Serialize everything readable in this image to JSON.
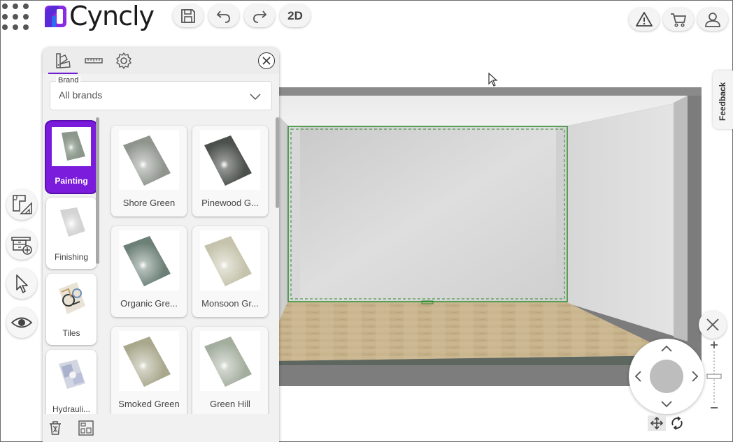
{
  "app": {
    "brand_name": "Cyncly",
    "toolbar": {
      "view_2d_label": "2D"
    }
  },
  "panel": {
    "brand_filter": {
      "legend": "Brand",
      "value": "All brands"
    },
    "categories": [
      {
        "label": "Painting",
        "active": true
      },
      {
        "label": "Finishing",
        "active": false
      },
      {
        "label": "Tiles",
        "active": false
      },
      {
        "label": "Hydrauli...",
        "active": false
      }
    ],
    "materials": [
      {
        "label": "Shore Green",
        "color": "#8f948d"
      },
      {
        "label": "Pinewood G...",
        "color": "#4b504c"
      },
      {
        "label": "Organic Gre...",
        "color": "#6c8077"
      },
      {
        "label": "Monsoon Gr...",
        "color": "#c5c3ab"
      },
      {
        "label": "Smoked Green",
        "color": "#a9a88d"
      },
      {
        "label": "Green Hill",
        "color": "#a4ae9f"
      }
    ]
  },
  "side": {
    "feedback_label": "Feedback"
  },
  "colors": {
    "accent": "#7b1bdc",
    "logo_purple": "#8a2be2",
    "logo_blue": "#2d6cf0",
    "selection_outline": "#2c8a2c"
  }
}
